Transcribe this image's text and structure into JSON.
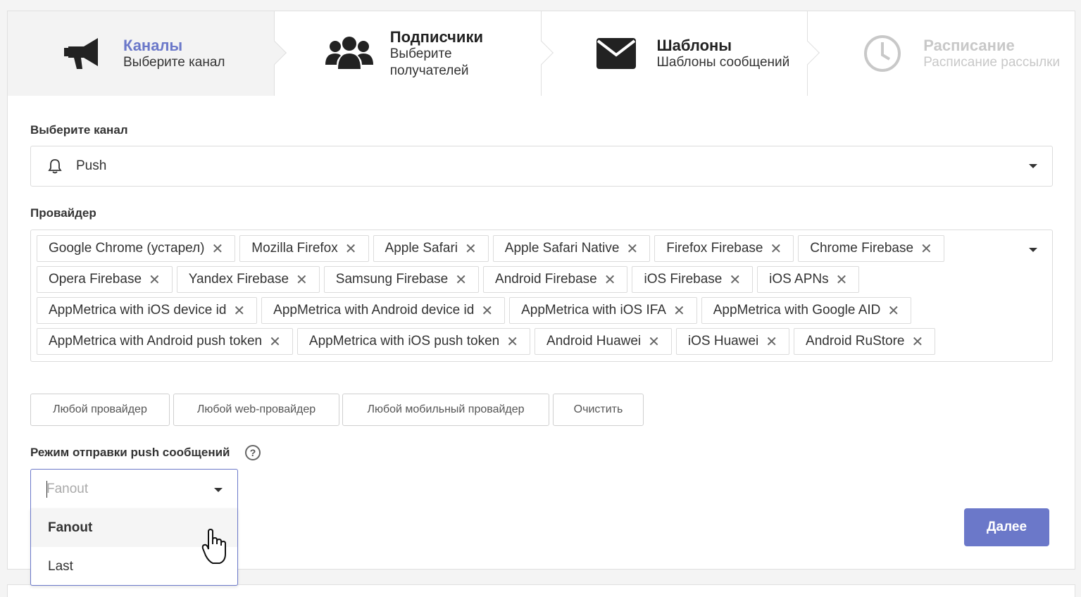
{
  "steps": [
    {
      "title": "Каналы",
      "desc": "Выберите канал",
      "icon": "megaphone-icon",
      "state": "active"
    },
    {
      "title": "Подписчики",
      "desc": "Выберите получателей",
      "icon": "users-icon",
      "state": "normal"
    },
    {
      "title": "Шаблоны",
      "desc": "Шаблоны сообщений",
      "icon": "envelope-icon",
      "state": "normal"
    },
    {
      "title": "Расписание",
      "desc": "Расписание рассылки",
      "icon": "clock-icon",
      "state": "disabled"
    }
  ],
  "channel": {
    "label": "Выберите канал",
    "value": "Push",
    "icon": "bell-icon"
  },
  "provider": {
    "label": "Провайдер",
    "tags": [
      "Google Chrome (устарел)",
      "Mozilla Firefox",
      "Apple Safari",
      "Apple Safari Native",
      "Firefox Firebase",
      "Chrome Firebase",
      "Opera Firebase",
      "Yandex Firebase",
      "Samsung Firebase",
      "Android Firebase",
      "iOS Firebase",
      "iOS APNs",
      "AppMetrica with iOS device id",
      "AppMetrica with Android device id",
      "AppMetrica with iOS IFA",
      "AppMetrica with Google AID",
      "AppMetrica with Android push token",
      "AppMetrica with iOS push token",
      "Android Huawei",
      "iOS Huawei",
      "Android RuStore"
    ],
    "remove_glyph": "✕"
  },
  "quick_buttons": {
    "any": "Любой провайдер",
    "any_web": "Любой web-провайдер",
    "any_mobile": "Любой мобильный провайдер",
    "clear": "Очистить"
  },
  "mode": {
    "label": "Режим отправки push сообщений",
    "help": "?",
    "placeholder": "Fanout",
    "options": [
      "Fanout",
      "Last"
    ],
    "selected": "Fanout"
  },
  "next_button": "Далее",
  "colors": {
    "accent": "#6b78c9",
    "active_step_bg": "#f3f3f3",
    "disabled_text": "#c8c8c8"
  }
}
